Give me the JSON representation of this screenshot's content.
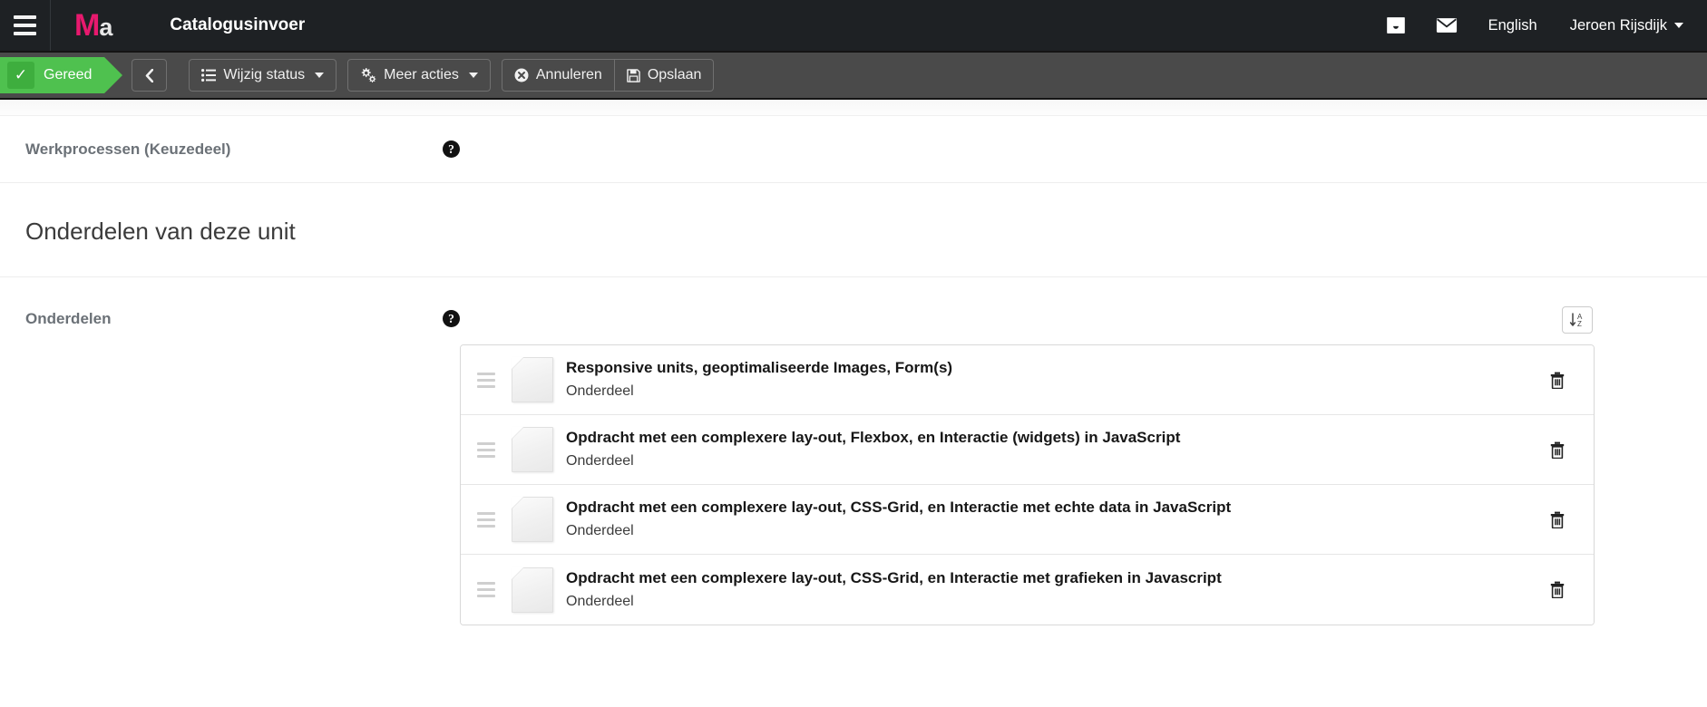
{
  "topnav": {
    "menu_icon": "hamburger-menu-icon",
    "brand_primary": "M",
    "brand_secondary": "a",
    "app_title": "Catalogusinvoer",
    "inbox_icon": "inbox-icon",
    "mail_icon": "envelope-icon",
    "language": "English",
    "user": "Jeroen Rijsdijk"
  },
  "toolbar": {
    "status_label": "Gereed",
    "status_check_icon": "check-icon",
    "back_label": "",
    "back_icon": "chevron-left-icon",
    "change_status_label": "Wijzig status",
    "change_status_icon": "list-icon",
    "more_actions_label": "Meer acties",
    "more_actions_icon": "gears-icon",
    "cancel_label": "Annuleren",
    "cancel_icon": "times-circle-icon",
    "save_label": "Opslaan",
    "save_icon": "floppy-disk-icon",
    "accent_green": "#4fc14f",
    "toolbar_bg": "#4a4a4a"
  },
  "fields": {
    "werkprocessen_label": "Werkprocessen (Keuzedeel)",
    "help_glyph": "?"
  },
  "section": {
    "heading": "Onderdelen van deze unit",
    "onderdelen_label": "Onderdelen",
    "sort_icon": "sort-alpha-asc-icon",
    "sort_letters_top": "A",
    "sort_letters_bottom": "Z"
  },
  "items": [
    {
      "title": "Responsive units, geoptimaliseerde Images, Form(s)",
      "subtitle": "Onderdeel",
      "doc_icon": "document-icon",
      "drag_icon": "drag-handle-icon",
      "delete_icon": "trash-icon"
    },
    {
      "title": "Opdracht met een complexere lay-out, Flexbox, en Interactie (widgets) in JavaScript",
      "subtitle": "Onderdeel",
      "doc_icon": "document-icon",
      "drag_icon": "drag-handle-icon",
      "delete_icon": "trash-icon"
    },
    {
      "title": "Opdracht met een complexere lay-out, CSS-Grid, en Interactie met echte data in JavaScript",
      "subtitle": "Onderdeel",
      "doc_icon": "document-icon",
      "drag_icon": "drag-handle-icon",
      "delete_icon": "trash-icon"
    },
    {
      "title": "Opdracht met een complexere lay-out, CSS-Grid, en Interactie met grafieken in Javascript",
      "subtitle": "Onderdeel",
      "doc_icon": "document-icon",
      "drag_icon": "drag-handle-icon",
      "delete_icon": "trash-icon"
    }
  ]
}
